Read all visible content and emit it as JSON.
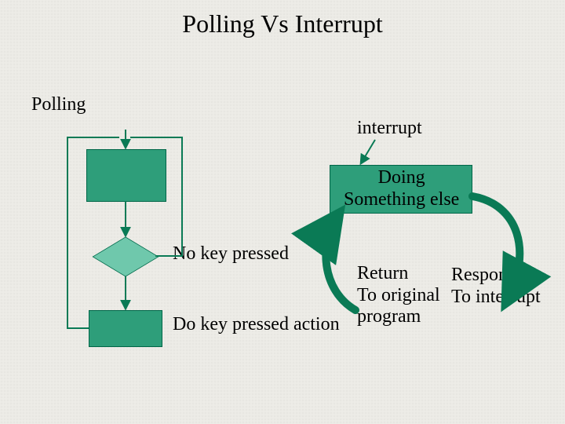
{
  "title": "Polling Vs Interrupt",
  "polling": {
    "heading": "Polling",
    "no_key": "No key pressed",
    "do_action": "Do key pressed action"
  },
  "interrupt": {
    "heading": "interrupt",
    "doing": "Doing\nSomething else",
    "return": "Return\nTo original\nprogram",
    "response": "Response\nTo interrupt"
  },
  "colors": {
    "box_fill": "#2e9e7a",
    "box_border": "#006648",
    "diamond_fill": "#6fc8ac",
    "arrow": "#0a7a55"
  },
  "chart_data": {
    "type": "diagram",
    "left_flow": {
      "title": "Polling",
      "nodes": [
        {
          "id": "poll_box1",
          "shape": "rect",
          "text": ""
        },
        {
          "id": "poll_decision",
          "shape": "diamond",
          "text": "",
          "right_label": "No key pressed"
        },
        {
          "id": "poll_box2",
          "shape": "rect",
          "text": "",
          "right_label": "Do key pressed action"
        }
      ],
      "edges": [
        {
          "from": "top",
          "to": "poll_box1"
        },
        {
          "from": "poll_box1",
          "to": "poll_decision"
        },
        {
          "from": "poll_decision",
          "to": "poll_box2",
          "label": ""
        },
        {
          "from": "poll_decision",
          "to": "poll_box1",
          "via": "right-loop",
          "label": "No key pressed"
        },
        {
          "from": "poll_box2",
          "to": "poll_box1",
          "via": "left-loop"
        }
      ]
    },
    "right_flow": {
      "title": "interrupt",
      "nodes": [
        {
          "id": "doing",
          "shape": "rect",
          "text": "Doing Something else"
        }
      ],
      "edges": [
        {
          "from": "interrupt_label",
          "to": "doing"
        },
        {
          "from": "doing",
          "to": "response",
          "label": "Response To interrupt",
          "style": "curve-right-down"
        },
        {
          "from": "response_area",
          "to": "doing",
          "label": "Return To original program",
          "style": "curve-left-up"
        }
      ]
    }
  }
}
